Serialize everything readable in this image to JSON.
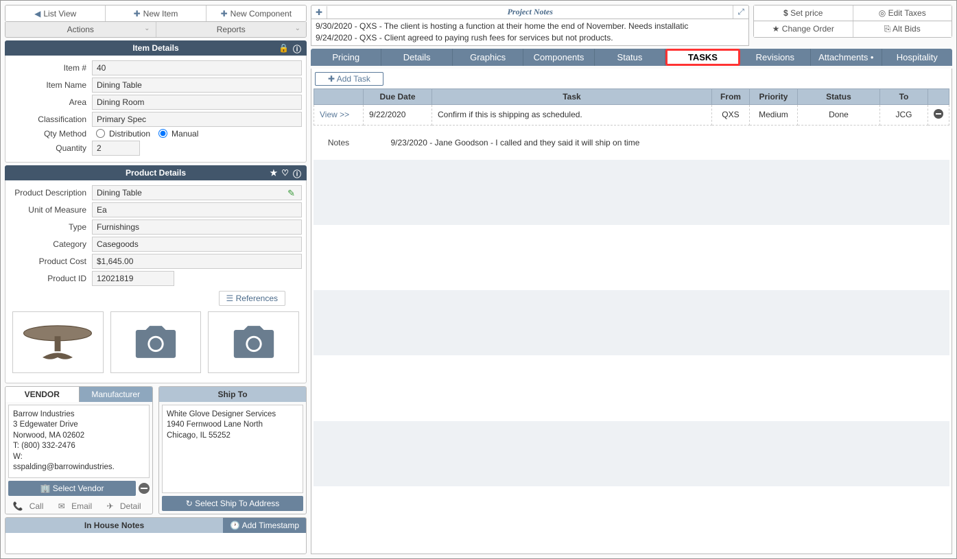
{
  "toolbar": {
    "list_view": "List View",
    "new_item": "New Item",
    "new_component": "New Component",
    "actions": "Actions",
    "reports": "Reports"
  },
  "item_details": {
    "header": "Item Details",
    "item_num_label": "Item #",
    "item_num": "40",
    "item_name_label": "Item Name",
    "item_name": "Dining Table",
    "area_label": "Area",
    "area": "Dining Room",
    "classification_label": "Classification",
    "classification": "Primary Spec",
    "qty_method_label": "Qty Method",
    "qty_method_dist": "Distribution",
    "qty_method_manual": "Manual",
    "quantity_label": "Quantity",
    "quantity": "2"
  },
  "product_details": {
    "header": "Product Details",
    "desc_label": "Product Description",
    "desc": "Dining Table",
    "uom_label": "Unit of Measure",
    "uom": "Ea",
    "type_label": "Type",
    "type": "Furnishings",
    "category_label": "Category",
    "category": "Casegoods",
    "cost_label": "Product Cost",
    "cost": "$1,645.00",
    "pid_label": "Product ID",
    "pid": "12021819",
    "references": "References"
  },
  "vendor": {
    "tab_vendor": "VENDOR",
    "tab_manufacturer": "Manufacturer",
    "line1": "Barrow Industries",
    "line2": "3 Edgewater Drive",
    "line3": "Norwood, MA 02602",
    "line4": "T: (800) 332-2476",
    "line5": "W:",
    "line6": "sspalding@barrowindustries.",
    "select_vendor": "Select Vendor",
    "call": "Call",
    "email": "Email",
    "detail": "Detail"
  },
  "ship_to": {
    "title": "Ship To",
    "line1": "White Glove Designer Services",
    "line2": "1940 Fernwood Lane North",
    "line3": "Chicago, IL 55252",
    "select_ship": "Select Ship To Address"
  },
  "in_house": {
    "title": "In House Notes",
    "add_ts": "Add Timestamp"
  },
  "project_notes": {
    "title": "Project Notes",
    "note1": "9/30/2020 - QXS - The client is hosting a function at their home the end of November. Needs installatic",
    "note2": "9/24/2020 - QXS - Client agreed to paying rush fees for services but not products."
  },
  "right_actions": {
    "set_price": "Set price",
    "edit_taxes": "Edit Taxes",
    "change_order": "Change Order",
    "alt_bids": "Alt Bids"
  },
  "tabs": {
    "pricing": "Pricing",
    "details": "Details",
    "graphics": "Graphics",
    "components": "Components",
    "status": "Status",
    "tasks": "TASKS",
    "revisions": "Revisions",
    "attachments": "Attachments •",
    "hospitality": "Hospitality"
  },
  "tasks_panel": {
    "add_task": "Add Task",
    "col_due": "Due Date",
    "col_task": "Task",
    "col_from": "From",
    "col_priority": "Priority",
    "col_status": "Status",
    "col_to": "To",
    "view": "View >>",
    "row_due": "9/22/2020",
    "row_task": "Confirm if this is shipping as scheduled.",
    "row_from": "QXS",
    "row_priority": "Medium",
    "row_status": "Done",
    "row_to": "JCG",
    "notes_label": "Notes",
    "notes_text": "9/23/2020 - Jane Goodson - I called and they said it will ship on time"
  }
}
